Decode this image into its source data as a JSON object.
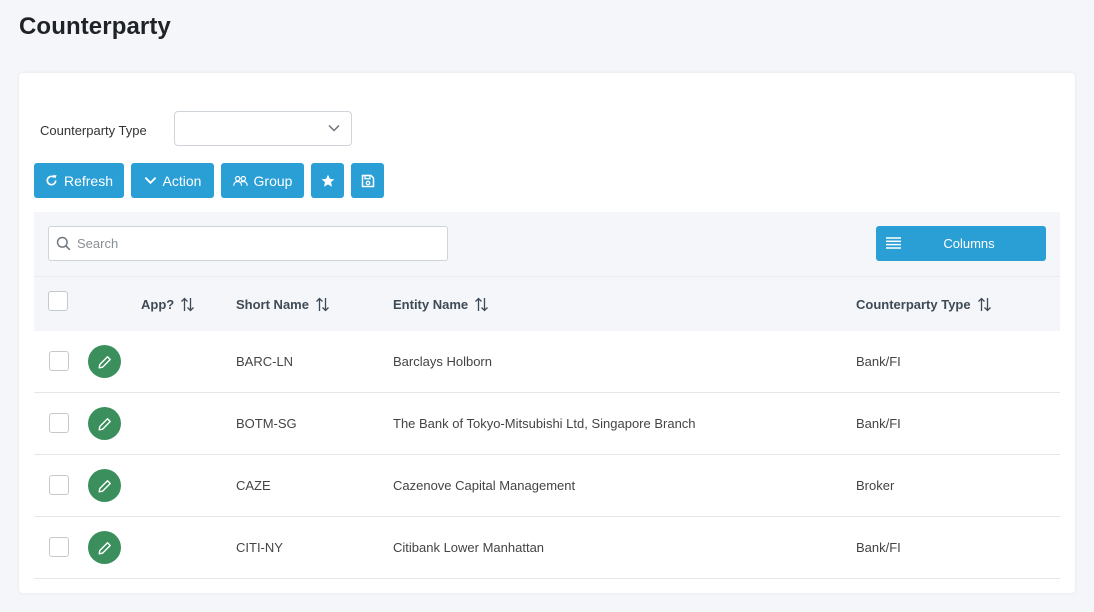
{
  "page": {
    "title": "Counterparty"
  },
  "filter": {
    "label": "Counterparty Type",
    "value": ""
  },
  "toolbar": {
    "refresh_label": "Refresh",
    "action_label": "Action",
    "group_label": "Group"
  },
  "search": {
    "placeholder": "Search",
    "value": ""
  },
  "columns_button": {
    "label": "Columns"
  },
  "table": {
    "headers": {
      "app": "App?",
      "short_name": "Short Name",
      "entity_name": "Entity Name",
      "counterparty_type": "Counterparty Type"
    },
    "rows": [
      {
        "short_name": "BARC-LN",
        "entity_name": "Barclays Holborn",
        "counterparty_type": "Bank/FI"
      },
      {
        "short_name": "BOTM-SG",
        "entity_name": "The Bank of Tokyo-Mitsubishi Ltd, Singapore Branch",
        "counterparty_type": "Bank/FI"
      },
      {
        "short_name": "CAZE",
        "entity_name": "Cazenove Capital Management",
        "counterparty_type": "Broker"
      },
      {
        "short_name": "CITI-NY",
        "entity_name": "Citibank Lower Manhattan",
        "counterparty_type": "Bank/FI"
      }
    ]
  },
  "colors": {
    "primary": "#2a9fd6",
    "edit": "#3a8f5c",
    "background": "#f4f6f9"
  },
  "icons": {
    "refresh": "refresh-icon",
    "action": "chevron-down-icon",
    "group": "group-icon",
    "favorite": "star-icon",
    "save": "save-icon",
    "search": "search-icon",
    "columns": "list-icon",
    "sort": "sort-icon",
    "edit": "pencil-icon"
  }
}
